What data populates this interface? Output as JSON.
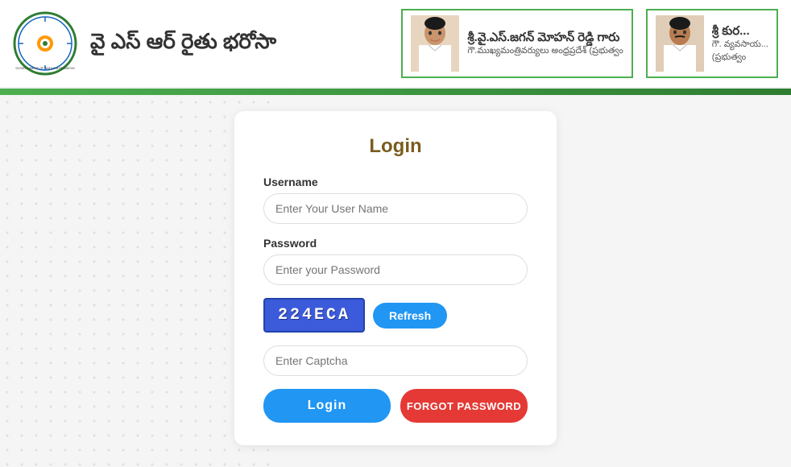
{
  "header": {
    "logo_alt": "Government of Andhra Pradesh Seal",
    "title": "వై ఎస్ ఆర్ రైతు భరోసా",
    "person1": {
      "name": "శ్రీ.వై.ఎస్.జగన్ మోహన్ రెడ్డి గారు",
      "title_line1": "గౌ.ముఖ్యమంత్రివర్యులు అంధ్రప్రదేశ్ (ప్రభుత్వం"
    },
    "person2": {
      "name": "శ్రీ కుర...",
      "title_line1": "గౌ. వ్యవసాయ...",
      "title_line2": "(ప్రభుత్వం"
    }
  },
  "login": {
    "title": "Login",
    "username_label": "Username",
    "username_placeholder": "Enter Your User Name",
    "password_label": "Password",
    "password_placeholder": "Enter your Password",
    "captcha_text": "224ECA",
    "refresh_label": "Refresh",
    "captcha_placeholder": "Enter Captcha",
    "login_btn": "Login",
    "forgot_btn": "FORGOT PASSWORD"
  },
  "colors": {
    "green_bar": "#4CAF50",
    "blue_btn": "#2196F3",
    "red_btn": "#e53935",
    "title_color": "#7a5c1e",
    "captcha_bg": "#3b5bdb"
  }
}
